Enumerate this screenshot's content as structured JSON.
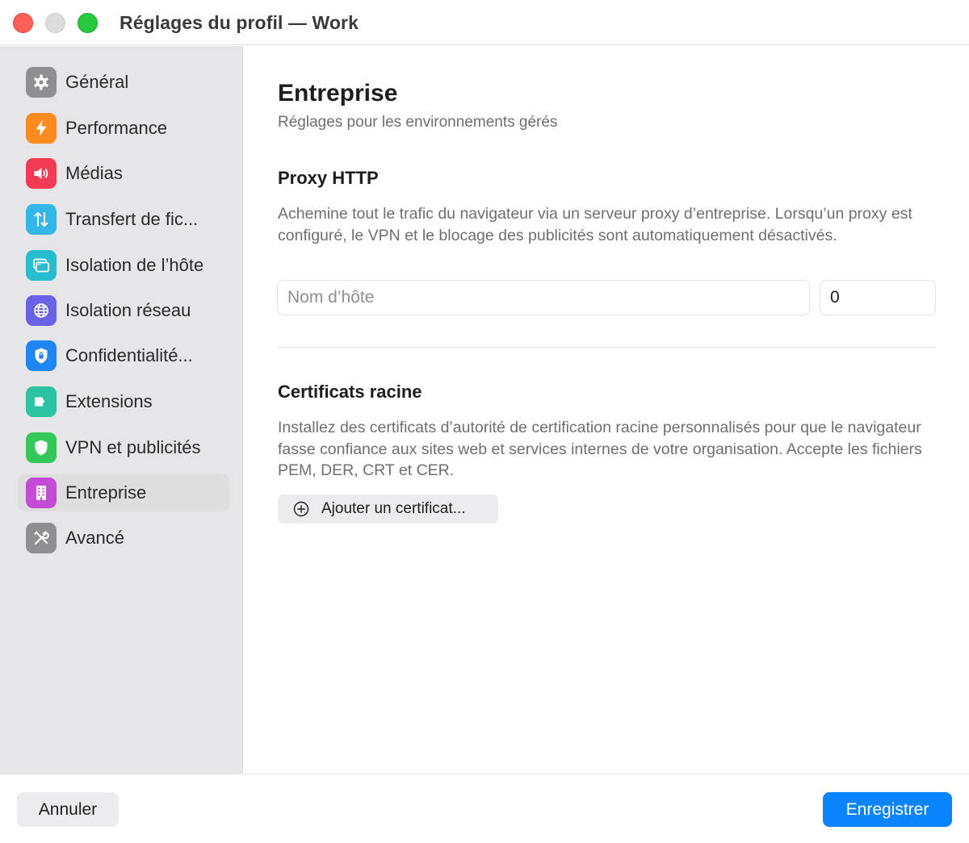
{
  "window": {
    "title": "Réglages du profil — Work"
  },
  "sidebar": {
    "items": [
      {
        "label": "Général",
        "icon": "gear-icon",
        "color": "#8e8e93"
      },
      {
        "label": "Performance",
        "icon": "bolt-icon",
        "color": "#ff8a1f"
      },
      {
        "label": "Médias",
        "icon": "speaker-icon",
        "color": "#f23a55"
      },
      {
        "label": "Transfert de fic...",
        "icon": "arrows-up-down-icon",
        "color": "#33b6e8"
      },
      {
        "label": "Isolation de l’hôte",
        "icon": "window-icon",
        "color": "#27bcd0"
      },
      {
        "label": "Isolation réseau",
        "icon": "globe-icon",
        "color": "#6a62e6"
      },
      {
        "label": "Confidentialité...",
        "icon": "lock-shield-icon",
        "color": "#1e86f0"
      },
      {
        "label": "Extensions",
        "icon": "puzzle-icon",
        "color": "#2cc3a2"
      },
      {
        "label": "VPN et publicités",
        "icon": "shield-icon",
        "color": "#34c759"
      },
      {
        "label": "Entreprise",
        "icon": "building-icon",
        "color": "#c44bd6"
      },
      {
        "label": "Avancé",
        "icon": "tools-icon",
        "color": "#8e8e93"
      }
    ],
    "active": "Entreprise"
  },
  "main": {
    "title": "Entreprise",
    "subtitle": "Réglages pour les environnements gérés",
    "proxy": {
      "title": "Proxy HTTP",
      "description": "Achemine tout le trafic du navigateur via un serveur proxy d’entreprise. Lorsqu’un proxy est configuré, le VPN et le blocage des publicités sont automatiquement désactivés.",
      "host_placeholder": "Nom d’hôte",
      "host_value": "",
      "port_value": "0"
    },
    "certificates": {
      "title": "Certificats racine",
      "description": "Installez des certificats d’autorité de certification racine personnalisés pour que le navigateur fasse confiance aux sites web et services internes de votre organisation. Accepte les fichiers PEM, DER, CRT et CER.",
      "add_label": "Ajouter un certificat..."
    }
  },
  "footer": {
    "cancel_label": "Annuler",
    "save_label": "Enregistrer",
    "accent_color": "#0a84ff"
  }
}
